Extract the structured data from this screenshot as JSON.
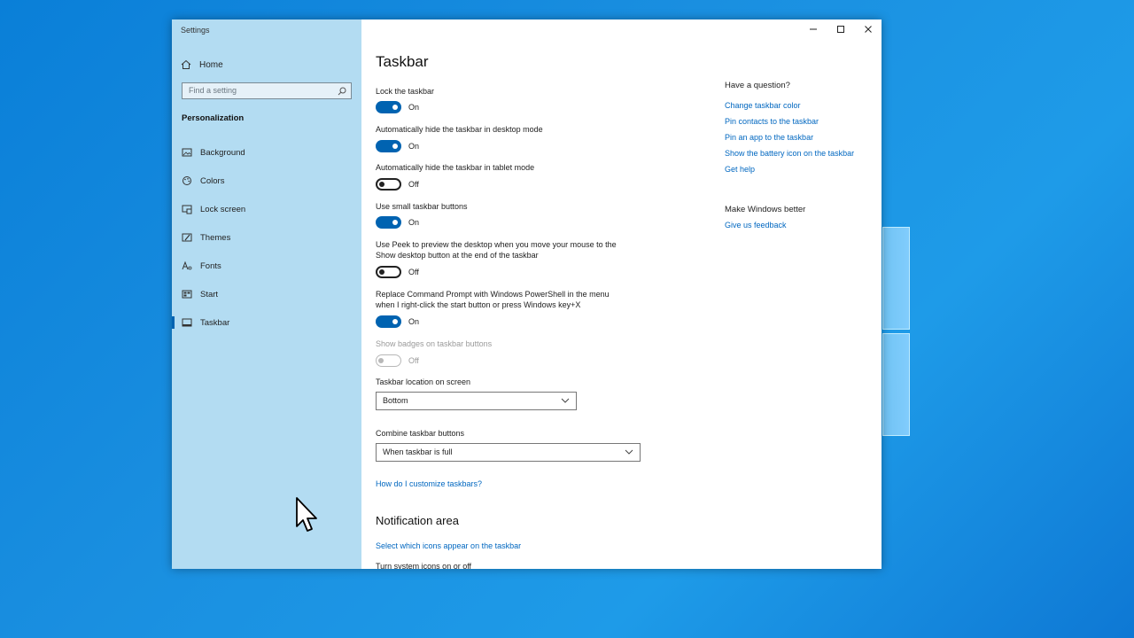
{
  "window": {
    "title": "Settings"
  },
  "sidebar": {
    "home_label": "Home",
    "search_placeholder": "Find a setting",
    "section_header": "Personalization",
    "items": [
      {
        "label": "Background",
        "icon": "image-icon"
      },
      {
        "label": "Colors",
        "icon": "palette-icon"
      },
      {
        "label": "Lock screen",
        "icon": "lock-screen-icon"
      },
      {
        "label": "Themes",
        "icon": "brush-icon"
      },
      {
        "label": "Fonts",
        "icon": "font-icon"
      },
      {
        "label": "Start",
        "icon": "start-icon"
      },
      {
        "label": "Taskbar",
        "icon": "taskbar-icon",
        "selected": true
      }
    ]
  },
  "main": {
    "title": "Taskbar",
    "settings": [
      {
        "label": "Lock the taskbar",
        "state": "On"
      },
      {
        "label": "Automatically hide the taskbar in desktop mode",
        "state": "On"
      },
      {
        "label": "Automatically hide the taskbar in tablet mode",
        "state": "Off"
      },
      {
        "label": "Use small taskbar buttons",
        "state": "On"
      },
      {
        "label_line1": "Use Peek to preview the desktop when you move your mouse to the",
        "label_line2": "Show desktop button at the end of the taskbar",
        "state": "Off"
      },
      {
        "label_line1": "Replace Command Prompt with Windows PowerShell in the menu",
        "label_line2": "when I right-click the start button or press Windows key+X",
        "state": "On"
      },
      {
        "label": "Show badges on taskbar buttons",
        "state": "Off",
        "disabled": true
      }
    ],
    "location": {
      "label": "Taskbar location on screen",
      "value": "Bottom"
    },
    "combine": {
      "label": "Combine taskbar buttons",
      "value": "When taskbar is full"
    },
    "help_link": "How do I customize taskbars?",
    "notification_title": "Notification area",
    "notification_link": "Select which icons appear on the taskbar",
    "cut_off_text": "Turn system icons on or off"
  },
  "right_panel": {
    "question_header": "Have a question?",
    "links": [
      "Change taskbar color",
      "Pin contacts to the taskbar",
      "Pin an app to the taskbar",
      "Show the battery icon on the taskbar",
      "Get help"
    ],
    "feedback_header": "Make Windows better",
    "feedback_link": "Give us feedback"
  },
  "colors": {
    "accent": "#0063b1",
    "link": "#0067c0",
    "sidebar": "#b3dcf2",
    "desktop": "#1a8fe0"
  }
}
